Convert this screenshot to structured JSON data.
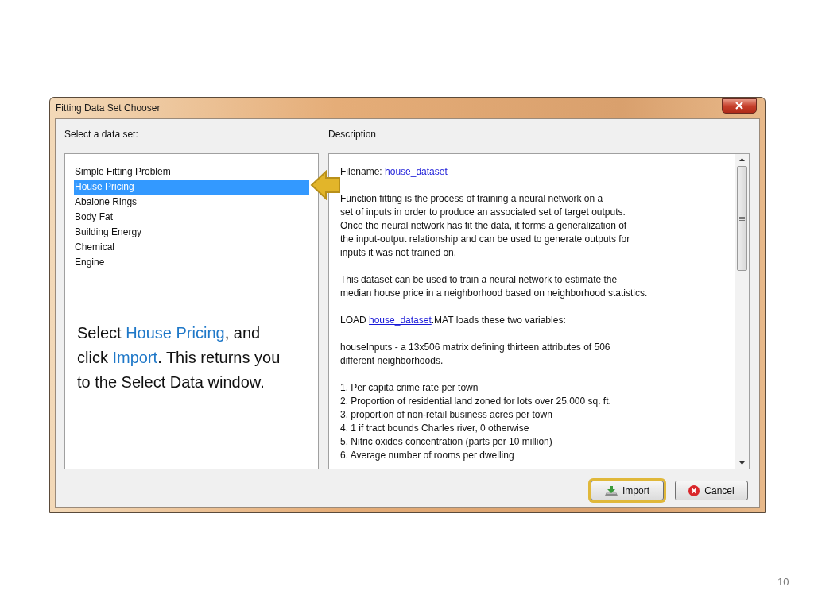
{
  "window": {
    "title": "Fitting Data Set Chooser"
  },
  "list_label": "Select a data set:",
  "datasets": [
    {
      "label": "Simple Fitting Problem",
      "selected": false
    },
    {
      "label": "House Pricing",
      "selected": true
    },
    {
      "label": "Abalone Rings",
      "selected": false
    },
    {
      "label": "Body Fat",
      "selected": false
    },
    {
      "label": "Building Energy",
      "selected": false
    },
    {
      "label": "Chemical",
      "selected": false
    },
    {
      "label": "Engine",
      "selected": false
    }
  ],
  "callout": [
    {
      "text": "Select ",
      "highlight": false
    },
    {
      "text": "House Pricing",
      "highlight": true
    },
    {
      "text": ", and click ",
      "highlight": false
    },
    {
      "text": "Import",
      "highlight": true
    },
    {
      "text": ". This returns you to the Select Data window.",
      "highlight": false
    }
  ],
  "description_label": "Description",
  "description": [
    [
      [
        {
          "text": "Filename: ",
          "link": false
        },
        {
          "text": "house_dataset",
          "link": true
        }
      ]
    ],
    [
      "Function fitting is the process of training a neural network on a",
      "set of inputs in order to produce an associated set of target outputs.",
      "Once the neural network has fit the data, it forms a generalization of",
      "the input-output relationship and can be used to generate outputs for",
      "inputs it was not trained on."
    ],
    [
      "This dataset can be used to train a neural network to estimate the",
      "median house price in a neighborhood based on neighborhood statistics."
    ],
    [
      [
        {
          "text": "LOAD ",
          "link": false
        },
        {
          "text": "house_dataset",
          "link": true
        },
        {
          "text": ".MAT loads these two variables:",
          "link": false
        }
      ]
    ],
    [
      "houseInputs - a 13x506 matrix defining thirteen attributes of 506",
      "different neighborhoods."
    ],
    [
      "1. Per capita crime rate per town",
      "2. Proportion of residential land zoned for lots over 25,000 sq. ft.",
      "3. proportion of non-retail business acres per town",
      "4. 1 if tract bounds Charles river, 0 otherwise",
      "5. Nitric oxides concentration (parts per 10 million)",
      "6. Average number of rooms per dwelling"
    ]
  ],
  "buttons": [
    {
      "label": "Import",
      "kind": "import",
      "highlighted": true
    },
    {
      "label": "Cancel",
      "kind": "cancel",
      "highlighted": false
    }
  ],
  "page_number": "10"
}
